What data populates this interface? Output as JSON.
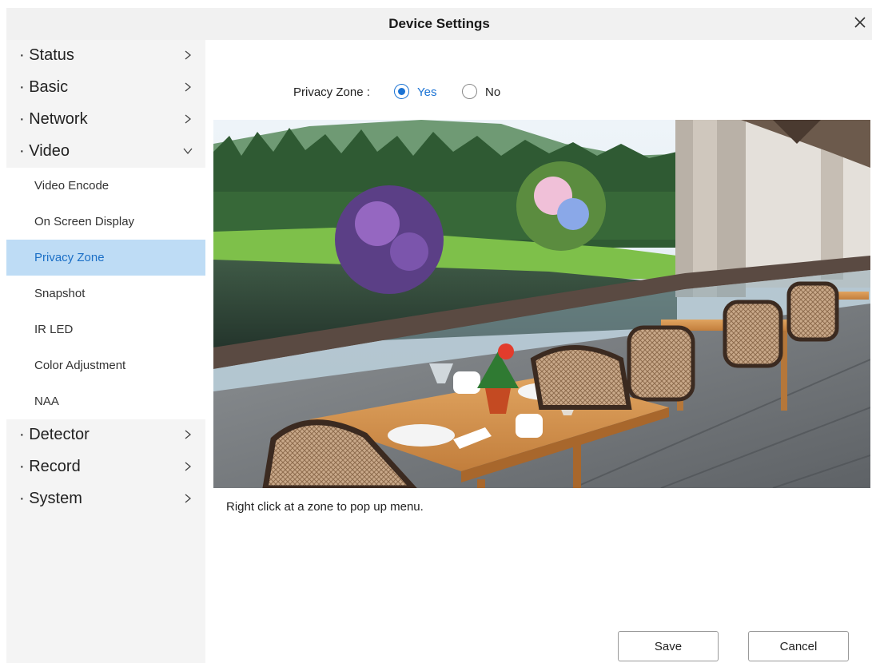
{
  "window": {
    "title": "Device Settings",
    "close_icon": "close-icon"
  },
  "sidebar": {
    "items": [
      {
        "label": "· Status",
        "icon": "chevron-right-icon"
      },
      {
        "label": "· Basic",
        "icon": "chevron-right-icon"
      },
      {
        "label": "· Network",
        "icon": "chevron-right-icon"
      },
      {
        "label": "· Video",
        "icon": "chevron-down-icon"
      },
      {
        "label": "· Detector",
        "icon": "chevron-right-icon"
      },
      {
        "label": "· Record",
        "icon": "chevron-right-icon"
      },
      {
        "label": "· System",
        "icon": "chevron-right-icon"
      }
    ],
    "video_subitems": [
      {
        "label": "Video Encode"
      },
      {
        "label": "On Screen Display"
      },
      {
        "label": "Privacy Zone",
        "active": true
      },
      {
        "label": "Snapshot"
      },
      {
        "label": "IR LED"
      },
      {
        "label": "Color Adjustment"
      },
      {
        "label": "NAA"
      }
    ]
  },
  "privacy_zone": {
    "label": "Privacy Zone :",
    "options": [
      {
        "label": "Yes",
        "checked": true
      },
      {
        "label": "No",
        "checked": false
      }
    ]
  },
  "preview": {
    "hint": "Right click at a zone to pop up menu."
  },
  "buttons": {
    "save": "Save",
    "cancel": "Cancel"
  },
  "colors": {
    "accent": "#1b73d4",
    "active_bg": "#bedcf5",
    "sidebar_bg": "#f4f4f4",
    "titlebar_bg": "#f1f1f1"
  }
}
